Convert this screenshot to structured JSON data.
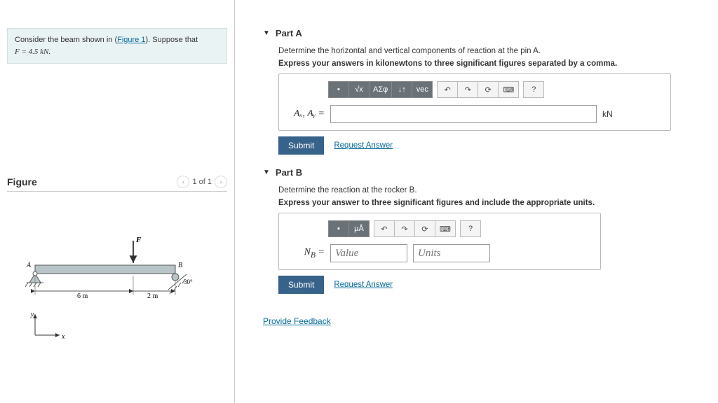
{
  "problem": {
    "pre": "Consider the beam shown in (",
    "fig_link": "Figure 1",
    "post": "). Suppose that",
    "eq": "F = 4.5 kN."
  },
  "figure": {
    "title": "Figure",
    "counter": "1 of 1",
    "labels": {
      "F": "F",
      "A": "A",
      "B": "B",
      "ang": "30°",
      "d1": "6 m",
      "d2": "2 m",
      "x": "x",
      "y": "y"
    }
  },
  "partA": {
    "header": "Part A",
    "instr": "Determine the horizontal and vertical components of reaction at the pin A.",
    "hint": "Express your answers in kilonewtons to three significant figures separated by a comma.",
    "lhs": "Aₓ, Aᵧ =",
    "unit": "kN",
    "toolbar": {
      "sqrt": "√x",
      "greek": "ΑΣφ",
      "sub": "↓↑",
      "vec": "vec",
      "undo": "↶",
      "redo": "↷",
      "reset": "⟳",
      "kbd": "⌨",
      "help": "?",
      "tmpl": "▪"
    }
  },
  "partB": {
    "header": "Part B",
    "instr": "Determine the reaction at the rocker B.",
    "hint": "Express your answer to three significant figures and include the appropriate units.",
    "lhs": "N_B =",
    "value_ph": "Value",
    "units_ph": "Units",
    "toolbar": {
      "tmpl": "▪",
      "mu": "µÅ",
      "undo": "↶",
      "redo": "↷",
      "reset": "⟳",
      "kbd": "⌨",
      "help": "?"
    }
  },
  "common": {
    "submit": "Submit",
    "request": "Request Answer",
    "feedback": "Provide Feedback"
  }
}
